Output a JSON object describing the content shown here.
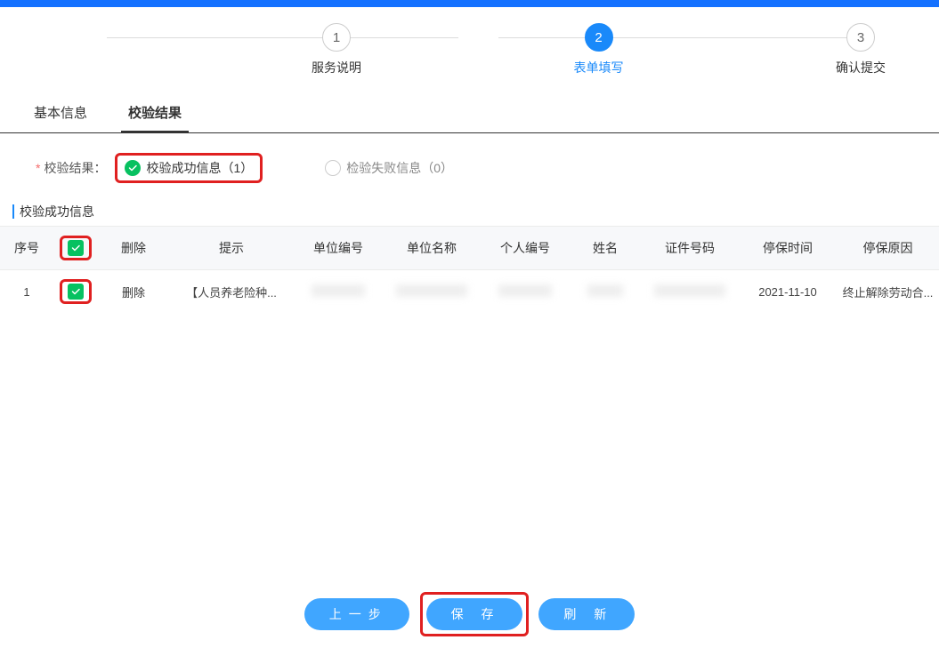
{
  "stepper": {
    "steps": [
      {
        "num": "1",
        "label": "服务说明",
        "active": false
      },
      {
        "num": "2",
        "label": "表单填写",
        "active": true
      },
      {
        "num": "3",
        "label": "确认提交",
        "active": false
      }
    ]
  },
  "tabs": {
    "items": [
      {
        "label": "基本信息",
        "active": false
      },
      {
        "label": "校验结果",
        "active": true
      }
    ]
  },
  "resultRow": {
    "label": "校验结果：",
    "successOption": "校验成功信息（1）",
    "failOption": "检验失败信息（0）"
  },
  "section": {
    "title": "校验成功信息"
  },
  "table": {
    "headers": [
      "序号",
      "",
      "删除",
      "提示",
      "单位编号",
      "单位名称",
      "个人编号",
      "姓名",
      "证件号码",
      "停保时间",
      "停保原因"
    ],
    "rows": [
      {
        "seq": "1",
        "checked": true,
        "delete": "删除",
        "tip": "【人员养老险种...",
        "unitNo": "",
        "unitName": "",
        "personNo": "",
        "name": "",
        "idNo": "",
        "stopTime": "2021-11-10",
        "stopReason": "终止解除劳动合..."
      }
    ]
  },
  "actions": {
    "prev": "上一步",
    "save": "保 存",
    "refresh": "刷 新"
  }
}
